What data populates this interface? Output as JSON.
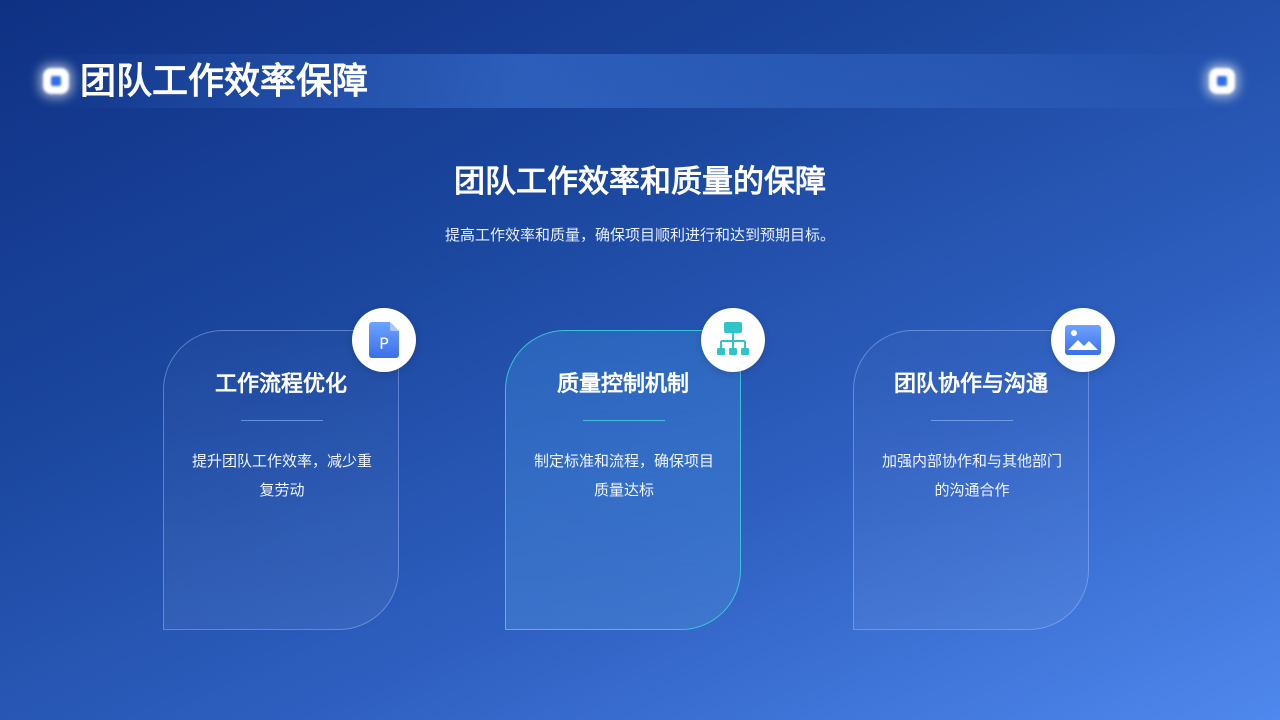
{
  "header": {
    "title": "团队工作效率保障"
  },
  "section": {
    "title": "团队工作效率和质量的保障",
    "subtitle": "提高工作效率和质量，确保项目顺利进行和达到预期目标。"
  },
  "cards": [
    {
      "title": "工作流程优化",
      "text": "提升团队工作效率，减少重复劳动",
      "icon": "document-p-icon"
    },
    {
      "title": "质量控制机制",
      "text": "制定标准和流程，确保项目质量达标",
      "icon": "hierarchy-icon"
    },
    {
      "title": "团队协作与沟通",
      "text": "加强内部协作和与其他部门的沟通合作",
      "icon": "image-icon"
    }
  ],
  "colors": {
    "accent_blue": "#3d7cf2",
    "accent_teal": "#2ec4c8",
    "background_dark": "#0f3184",
    "background_light": "#4f88ee"
  }
}
